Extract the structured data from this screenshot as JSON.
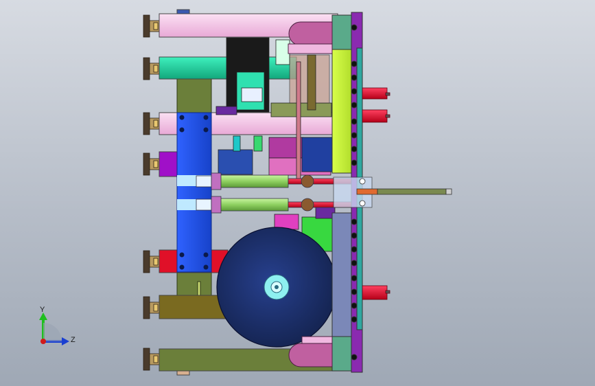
{
  "viewport": {
    "background_top": "#d7dbe2",
    "background_bottom": "#9fa8b5"
  },
  "triad": {
    "y_label": "Y",
    "z_label": "Z",
    "y_axis_color": "#1fbf1f",
    "z_axis_color": "#1a3fd1",
    "x_axis_color": "#d11a1a"
  },
  "model": {
    "colors": {
      "pink_beam": "#f7c6e8",
      "teal_beam": "#22d3a0",
      "olive_post": "#6b7f3a",
      "blue_column": "#2457f0",
      "lime_plate": "#c6f23a",
      "slate_plate": "#7b88b8",
      "red_beam": "#e01028",
      "magenta_block": "#a010c8",
      "disk": "#1c2f6e",
      "disk_hub": "#8ef0f0",
      "cylinder": "#9ed870",
      "leveling_foot": "#5a4a3a",
      "black_motor": "#1a1a1a",
      "rod_red": "#e8103c"
    }
  }
}
